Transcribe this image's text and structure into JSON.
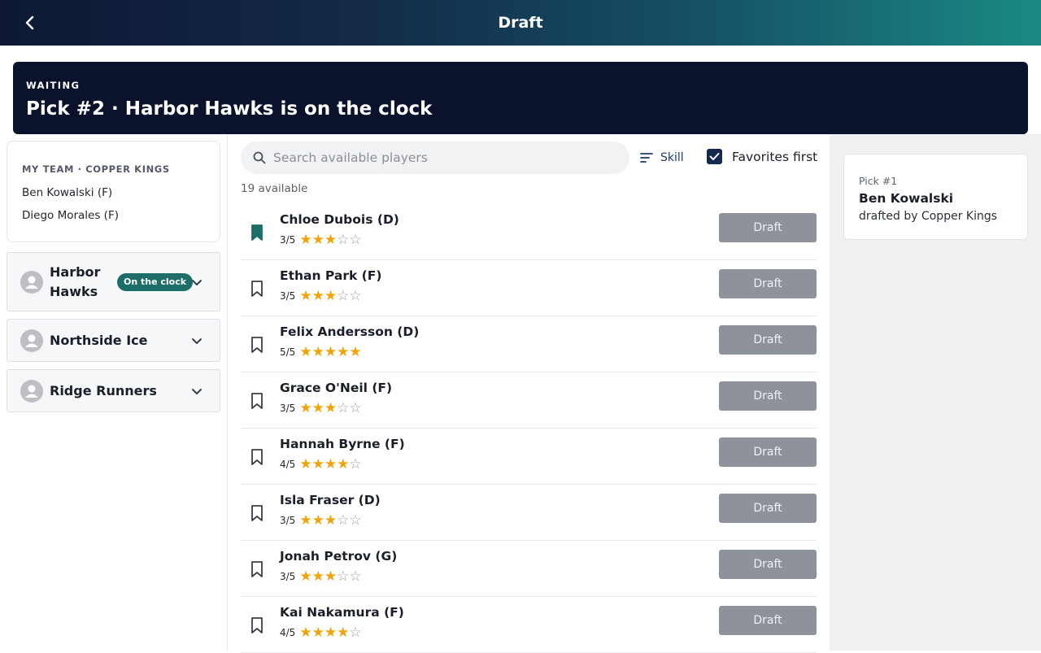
{
  "header": {
    "title": "Draft"
  },
  "banner": {
    "status": "WAITING",
    "title": "Pick #2 · Harbor Hawks is on the clock"
  },
  "my_team": {
    "label": "MY TEAM · COPPER KINGS",
    "players": [
      "Ben Kowalski (F)",
      "Diego Morales (F)"
    ]
  },
  "teams": [
    {
      "name": "Harbor Hawks",
      "badge": "On the clock"
    },
    {
      "name": "Northside Ice"
    },
    {
      "name": "Ridge Runners"
    }
  ],
  "search": {
    "placeholder": "Search available players",
    "value": ""
  },
  "sort": {
    "label": "Skill",
    "icon": "sort-lines-icon"
  },
  "favorites_first": {
    "label": "Favorites first",
    "checked": true
  },
  "available_count": "19 available",
  "players": [
    {
      "name": "Chloe Dubois (D)",
      "rating_text": "3/5",
      "rating": 3,
      "favorite": true,
      "action": "Draft"
    },
    {
      "name": "Ethan Park (F)",
      "rating_text": "3/5",
      "rating": 3,
      "favorite": false,
      "action": "Draft"
    },
    {
      "name": "Felix Andersson (D)",
      "rating_text": "5/5",
      "rating": 5,
      "favorite": false,
      "action": "Draft"
    },
    {
      "name": "Grace O'Neil (F)",
      "rating_text": "3/5",
      "rating": 3,
      "favorite": false,
      "action": "Draft"
    },
    {
      "name": "Hannah Byrne (F)",
      "rating_text": "4/5",
      "rating": 4,
      "favorite": false,
      "action": "Draft"
    },
    {
      "name": "Isla Fraser (D)",
      "rating_text": "3/5",
      "rating": 3,
      "favorite": false,
      "action": "Draft"
    },
    {
      "name": "Jonah Petrov (G)",
      "rating_text": "3/5",
      "rating": 3,
      "favorite": false,
      "action": "Draft"
    },
    {
      "name": "Kai Nakamura (F)",
      "rating_text": "4/5",
      "rating": 4,
      "favorite": false,
      "action": "Draft"
    }
  ],
  "picks": [
    {
      "number": "Pick #1",
      "player": "Ben Kowalski",
      "by": "drafted by Copper Kings"
    }
  ],
  "colors": {
    "accent_teal": "#1d6d68",
    "banner_bg": "#0b132c",
    "star_on": "#f0a40c",
    "draft_button": "#8d929b"
  }
}
